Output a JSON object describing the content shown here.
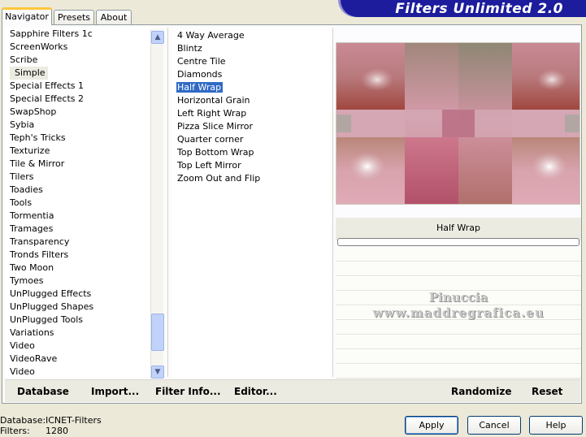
{
  "app": {
    "title": "Filters Unlimited 2.0"
  },
  "tabs": [
    {
      "label": "Navigator"
    },
    {
      "label": "Presets"
    },
    {
      "label": "About"
    }
  ],
  "categories": {
    "items": [
      "Sapphire Filters 1c",
      "ScreenWorks",
      "Scribe",
      "Simple",
      "Special Effects 1",
      "Special Effects 2",
      "SwapShop",
      "Sybia",
      "Teph's Tricks",
      "Texturize",
      "Tile & Mirror",
      "Tilers",
      "Toadies",
      "Tools",
      "Tormentia",
      "Tramages",
      "Transparency",
      "Tronds Filters",
      "Two Moon",
      "Tymoes",
      "UnPlugged Effects",
      "UnPlugged Shapes",
      "UnPlugged Tools",
      "Variations",
      "Video",
      "VideoRave",
      "Video"
    ],
    "selected": "Simple",
    "scroll_position_fraction": 0.85
  },
  "filters": {
    "items": [
      "4 Way Average",
      "Blintz",
      "Centre Tile",
      "Diamonds",
      "Half Wrap",
      "Horizontal Grain",
      "Left Right Wrap",
      "Pizza Slice Mirror",
      "Quarter corner",
      "Top Bottom Wrap",
      "Top Left Mirror",
      "Zoom Out and Flip"
    ],
    "selected": "Half Wrap"
  },
  "preview": {
    "filter_name": "Half Wrap",
    "watermark_line1": "Pinuccia",
    "watermark_line2": "www.maddregrafica.eu",
    "progress_fraction": 0
  },
  "toolbar": {
    "database": "Database",
    "import": "Import...",
    "filter_info": "Filter Info...",
    "editor": "Editor...",
    "randomize": "Randomize",
    "reset": "Reset"
  },
  "footer": {
    "database_label": "Database:",
    "database_value": "ICNET-Filters",
    "filters_label": "Filters:",
    "filters_value": "1280",
    "apply": "Apply",
    "cancel": "Cancel",
    "help": "Help"
  },
  "colors": {
    "banner": "#1c1c9c",
    "selection": "#316ac5",
    "window_bg": "#ece9d8",
    "tab_accent": "#ffc73c"
  }
}
